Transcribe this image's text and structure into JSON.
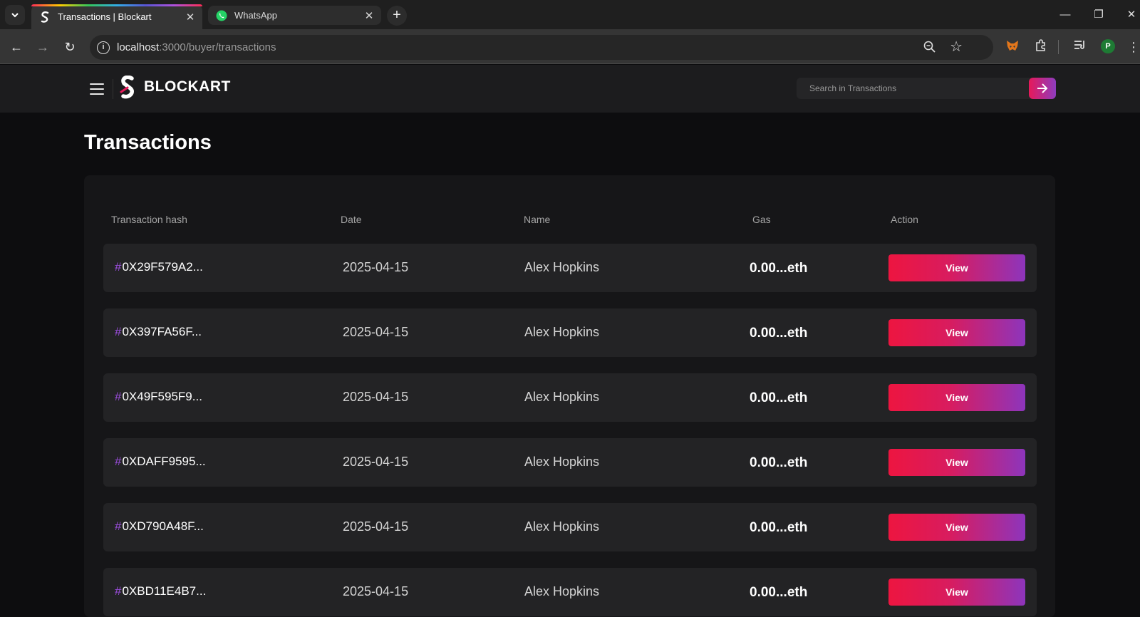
{
  "browser": {
    "tabs": [
      {
        "title": "Transactions | Blockart",
        "active": true,
        "icon": "blockart-favicon"
      },
      {
        "title": "WhatsApp",
        "active": false,
        "icon": "whatsapp-icon"
      }
    ],
    "url_host": "localhost",
    "url_rest": ":3000/buyer/transactions",
    "profile_initial": "P"
  },
  "app": {
    "brand": "BLOCKART",
    "search_placeholder": "Search in Transactions",
    "page_title": "Transactions",
    "accent_start": "#ed1540",
    "accent_end": "#8d35bc"
  },
  "table": {
    "headers": [
      "Transaction hash",
      "Date",
      "Name",
      "Gas",
      "Action"
    ],
    "rows": [
      {
        "hash": "0X29F579A2...",
        "date": "2025-04-15",
        "name": "Alex Hopkins",
        "gas": "0.00...eth",
        "action": "View"
      },
      {
        "hash": "0X397FA56F...",
        "date": "2025-04-15",
        "name": "Alex Hopkins",
        "gas": "0.00...eth",
        "action": "View"
      },
      {
        "hash": "0X49F595F9...",
        "date": "2025-04-15",
        "name": "Alex Hopkins",
        "gas": "0.00...eth",
        "action": "View"
      },
      {
        "hash": "0XDAFF9595...",
        "date": "2025-04-15",
        "name": "Alex Hopkins",
        "gas": "0.00...eth",
        "action": "View"
      },
      {
        "hash": "0XD790A48F...",
        "date": "2025-04-15",
        "name": "Alex Hopkins",
        "gas": "0.00...eth",
        "action": "View"
      },
      {
        "hash": "0XBD11E4B7...",
        "date": "2025-04-15",
        "name": "Alex Hopkins",
        "gas": "0.00...eth",
        "action": "View"
      }
    ]
  }
}
